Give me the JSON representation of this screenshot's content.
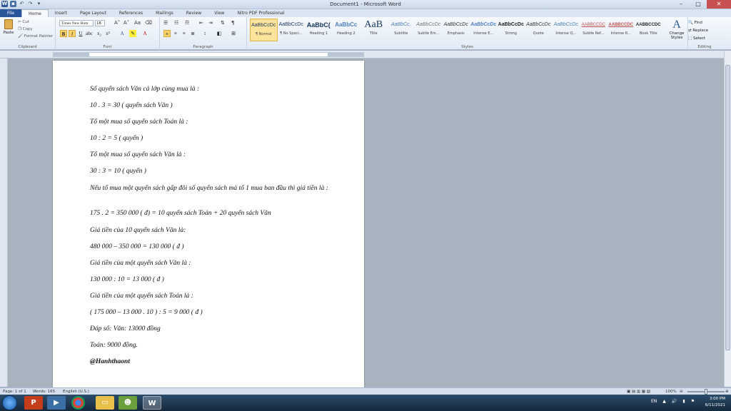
{
  "window": {
    "title": "Document1 - Microsoft Word",
    "minimize": "–",
    "maximize": "□",
    "close": "✕"
  },
  "qat": {
    "app": "W",
    "save": "▪",
    "undo": "↶",
    "redo": "↷",
    "customize": "▾"
  },
  "tabs": [
    "File",
    "Home",
    "Insert",
    "Page Layout",
    "References",
    "Mailings",
    "Review",
    "View",
    "Nitro PDF Professional"
  ],
  "ribbon": {
    "clipboard": {
      "paste": "Paste",
      "cut": "Cut",
      "copy": "Copy",
      "format_painter": "Format Painter",
      "label": "Clipboard"
    },
    "font": {
      "name": "Times New Rom",
      "size": "16",
      "label": "Font"
    },
    "paragraph": {
      "label": "Paragraph"
    },
    "styles": {
      "label": "Styles",
      "items": [
        {
          "sample": "AaBbCcDc",
          "name": "¶ Normal"
        },
        {
          "sample": "AaBbCcDc",
          "name": "¶ No Spaci..."
        },
        {
          "sample": "AaBbC(",
          "name": "Heading 1"
        },
        {
          "sample": "AaBbCc",
          "name": "Heading 2"
        },
        {
          "sample": "AaB",
          "name": "Title"
        },
        {
          "sample": "AaBbCc.",
          "name": "Subtitle"
        },
        {
          "sample": "AaBbCcDc",
          "name": "Subtle Em..."
        },
        {
          "sample": "AaBbCcDc",
          "name": "Emphasis"
        },
        {
          "sample": "AaBbCcDc",
          "name": "Intense E..."
        },
        {
          "sample": "AaBbCcDc",
          "name": "Strong"
        },
        {
          "sample": "AaBbCcDc",
          "name": "Quote"
        },
        {
          "sample": "AaBbCcDc",
          "name": "Intense Q..."
        },
        {
          "sample": "AABBCCDC",
          "name": "Subtle Ref..."
        },
        {
          "sample": "AABBCCDC",
          "name": "Intense R..."
        },
        {
          "sample": "AABBCCDC",
          "name": "Book Title"
        }
      ],
      "change_styles": "Change Styles"
    },
    "editing": {
      "find": "Find",
      "replace": "Replace",
      "select": "Select",
      "label": "Editing"
    }
  },
  "document": {
    "paragraphs": [
      "Số quyển sách Văn cả lớp cùng mua là :",
      "10 . 3 = 30 ( quyển sách Văn )",
      "Tổ một mua số quyển sách Toán là :",
      "10 : 2 = 5 ( quyển )",
      "Tổ một mua số quyển sách Văn là :",
      "30 : 3 = 10 ( quyển )",
      "Nếu tổ mua một quyển sách gấp đôi số quyển sách mà tổ 1 mua ban đầu thì giá tiền là :",
      "175 . 2 = 350 000 ( đ) = 10 quyển sách Toán + 20 quyển sách Văn",
      "Giá tiền của 10 quyển sách Văn là:",
      "480 000 – 350 000 = 130 000 ( đ )",
      "Giá tiền của một quyển sách Văn là :",
      "130 000 : 10 = 13 000 ( đ )",
      "Giá tiền của một quyển sách Toán là :",
      "( 175 000 – 13 000 . 10 ) : 5 = 9 000 ( đ )",
      "Đáp số: Văn: 13000 đồng",
      " Toán: 9000 đồng.",
      "@Hanhthaont"
    ]
  },
  "statusbar": {
    "page": "Page: 1 of 1",
    "words": "Words: 165",
    "language": "English (U.S.)",
    "zoom": "100%"
  },
  "taskbar": {
    "language": "EN",
    "time": "3:00 PM",
    "date": "6/11/2021"
  }
}
